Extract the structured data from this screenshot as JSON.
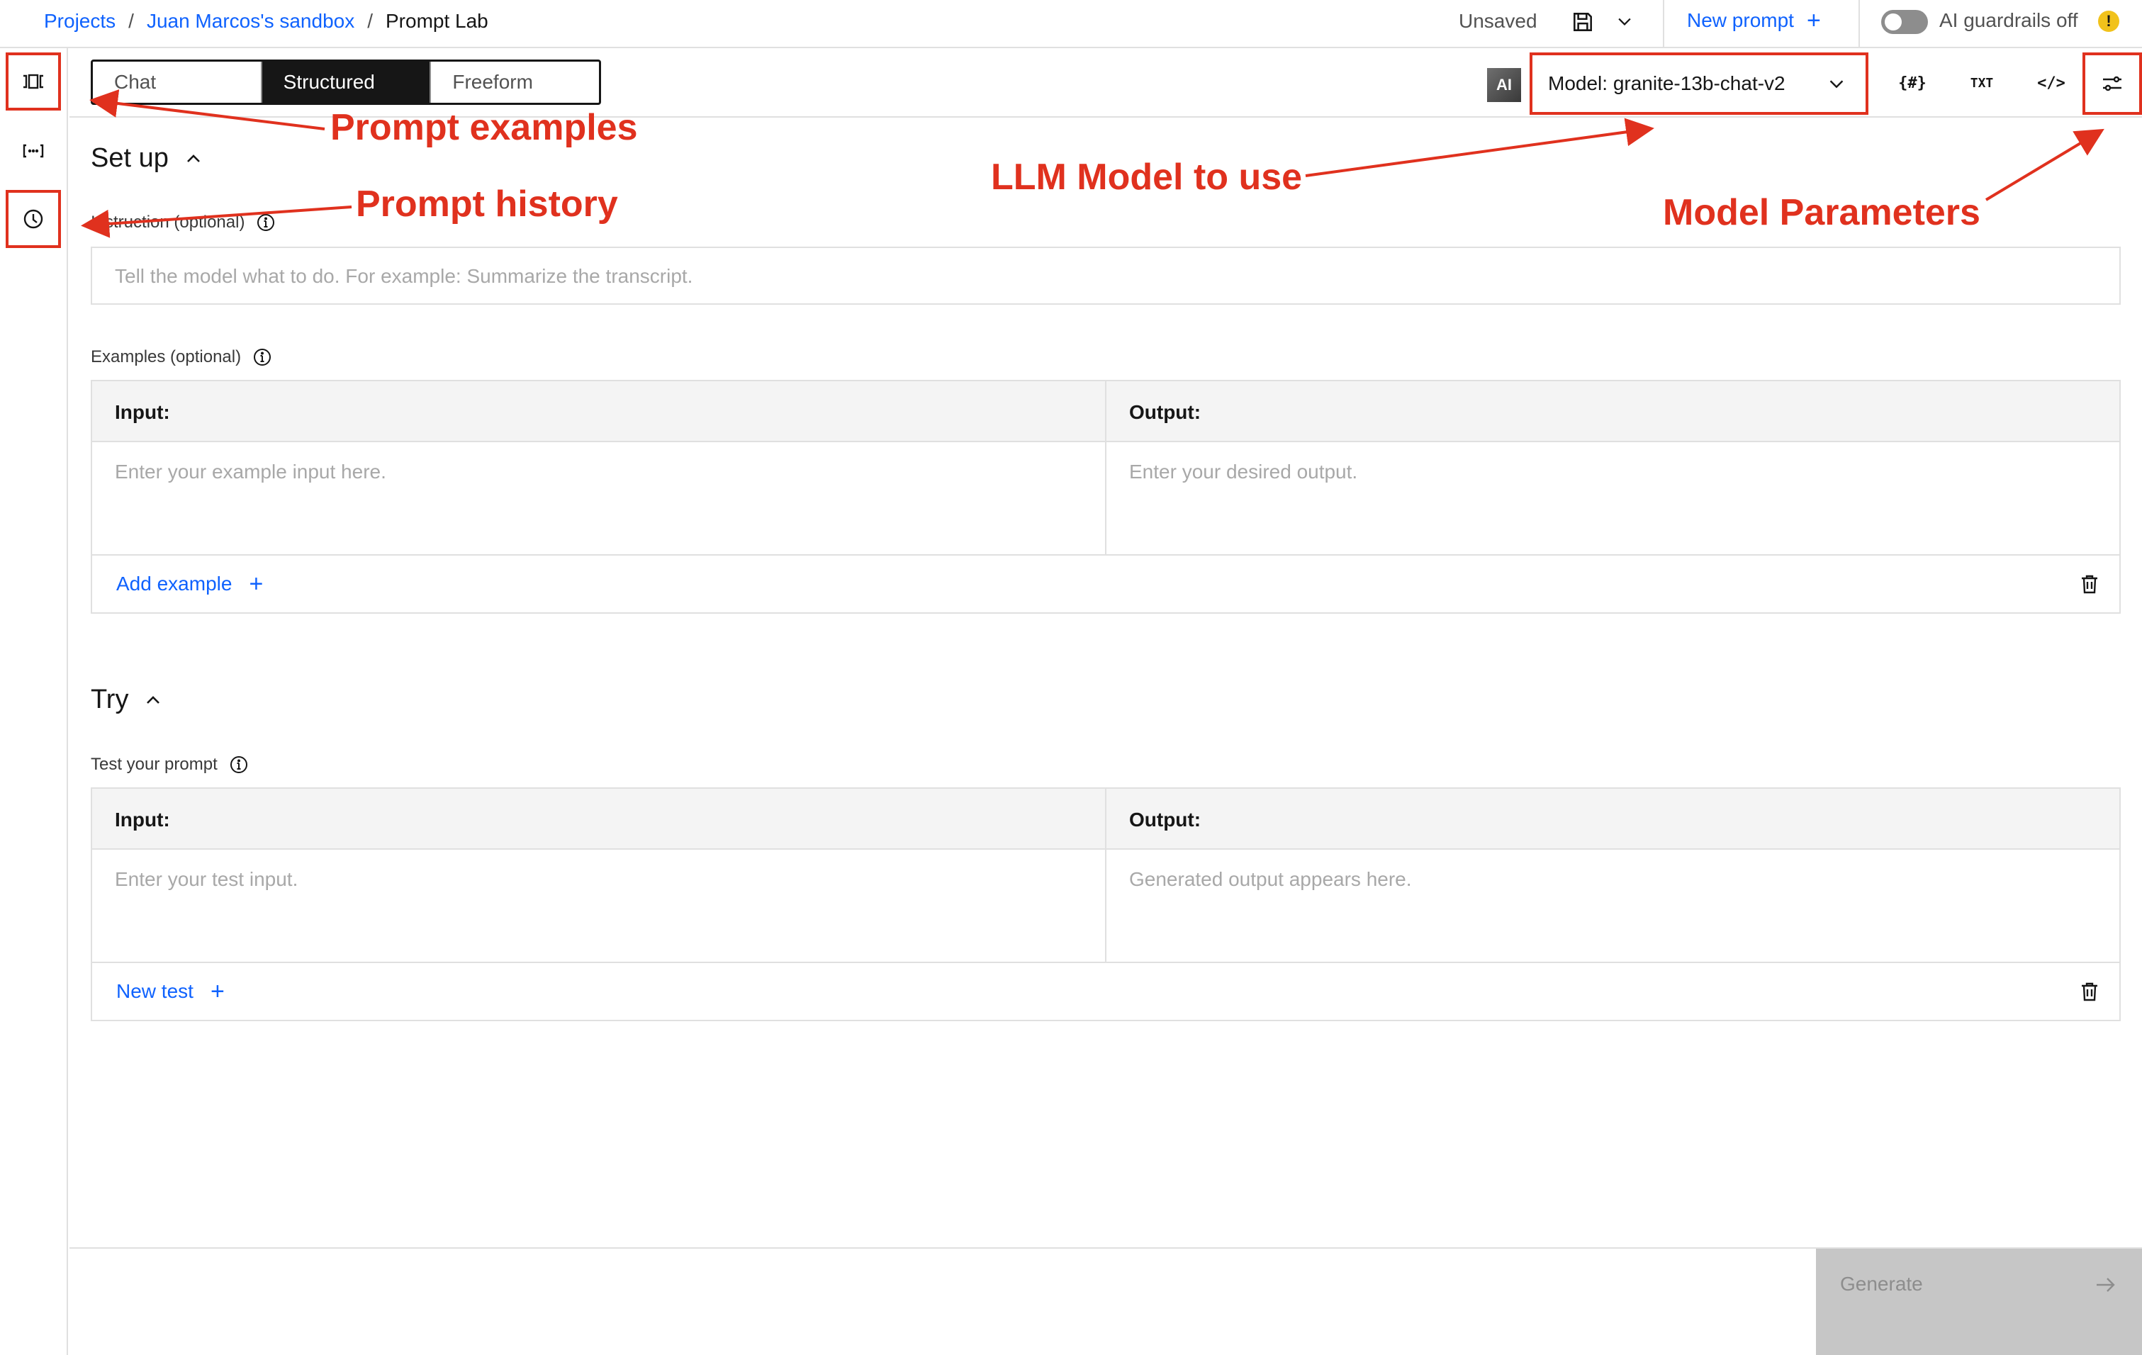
{
  "breadcrumb": {
    "items": [
      "Projects",
      "Juan Marcos's sandbox"
    ],
    "separator": "/",
    "current": "Prompt Lab"
  },
  "header": {
    "status": "Unsaved",
    "new_prompt_label": "New prompt",
    "guardrails_label": "AI guardrails off"
  },
  "mode_tabs": [
    "Chat",
    "Structured",
    "Freeform"
  ],
  "active_mode": "Structured",
  "toolbar": {
    "ai_badge": "AI",
    "model_label": "Model: granite-13b-chat-v2",
    "icon_vars": "{#}",
    "icon_txt": "TXT",
    "icon_code": "</>"
  },
  "setup": {
    "title": "Set up",
    "instruction_label": "Instruction (optional)",
    "instruction_placeholder": "Tell the model what to do. For example: Summarize the transcript.",
    "examples_label": "Examples (optional)",
    "input_header": "Input:",
    "output_header": "Output:",
    "input_placeholder": "Enter your example input here.",
    "output_placeholder": "Enter your desired output.",
    "add_example": "Add example"
  },
  "try": {
    "title": "Try",
    "test_label": "Test your prompt",
    "input_header": "Input:",
    "output_header": "Output:",
    "input_placeholder": "Enter your test input.",
    "output_placeholder": "Generated output appears here.",
    "new_test": "New test"
  },
  "footer": {
    "generate_label": "Generate"
  },
  "annotations": {
    "prompt_examples": "Prompt examples",
    "prompt_history": "Prompt history",
    "llm_model": "LLM Model to use",
    "model_parameters": "Model Parameters"
  },
  "colors": {
    "annotation_red": "#e0311e",
    "link_blue": "#0f62fe",
    "warning_yellow": "#f1c21b"
  }
}
